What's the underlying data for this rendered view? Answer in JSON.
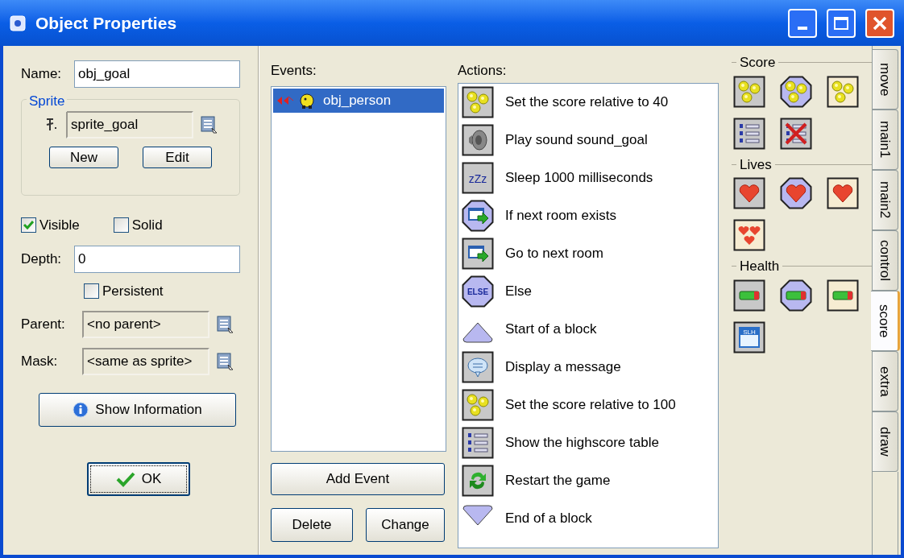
{
  "window": {
    "title": "Object Properties"
  },
  "name": {
    "label": "Name:",
    "value": "obj_goal"
  },
  "sprite": {
    "title": "Sprite",
    "value": "sprite_goal",
    "buttons": [
      "New",
      "Edit"
    ]
  },
  "checkboxes": [
    {
      "label": "Visible",
      "checked": true
    },
    {
      "label": "Solid",
      "checked": false
    }
  ],
  "depth": {
    "label": "Depth:",
    "value": "0"
  },
  "persistent": {
    "label": "Persistent",
    "checked": false
  },
  "parent": {
    "label": "Parent:",
    "value": "<no parent>"
  },
  "mask": {
    "label": "Mask:",
    "value": "<same as sprite>"
  },
  "show_information": "Show Information",
  "ok": "OK",
  "events": {
    "label": "Events:",
    "items": [
      {
        "label": "obj_person",
        "selected": true
      }
    ],
    "buttons": {
      "add": "Add Event",
      "delete": "Delete",
      "change": "Change"
    }
  },
  "actions": {
    "label": "Actions:",
    "items": [
      {
        "kind": "coins",
        "text": "Set the score relative to 40"
      },
      {
        "kind": "speaker",
        "text": "Play sound sound_goal"
      },
      {
        "kind": "sleep",
        "icon_text": "zZz",
        "text": "Sleep 1000 milliseconds"
      },
      {
        "kind": "if_room",
        "text": "If next room exists"
      },
      {
        "kind": "next_room",
        "text": "Go to next room"
      },
      {
        "kind": "else",
        "icon_text": "ELSE",
        "text": "Else"
      },
      {
        "kind": "start_block",
        "text": "Start of a block"
      },
      {
        "kind": "message",
        "text": "Display a message"
      },
      {
        "kind": "coins",
        "text": "Set the score relative to 100"
      },
      {
        "kind": "highscore",
        "text": "Show the highscore table"
      },
      {
        "kind": "restart",
        "text": "Restart the game"
      },
      {
        "kind": "end_block",
        "text": "End of a block"
      }
    ]
  },
  "library": [
    {
      "title": "Score",
      "items": [
        {
          "kind": "score_set"
        },
        {
          "kind": "score_test"
        },
        {
          "kind": "score_draw"
        },
        {
          "kind": "highscore_show"
        },
        {
          "kind": "highscore_clear"
        }
      ]
    },
    {
      "title": "Lives",
      "items": [
        {
          "kind": "lives_set"
        },
        {
          "kind": "lives_test"
        },
        {
          "kind": "lives_draw"
        },
        {
          "kind": "lives_draw_image"
        }
      ]
    },
    {
      "title": "Health",
      "items": [
        {
          "kind": "health_set"
        },
        {
          "kind": "health_test"
        },
        {
          "kind": "health_draw"
        },
        {
          "kind": "caption",
          "icon_text": "SLH"
        }
      ]
    }
  ],
  "tabs": [
    {
      "label": "move",
      "selected": false
    },
    {
      "label": "main1",
      "selected": false
    },
    {
      "label": "main2",
      "selected": false
    },
    {
      "label": "control",
      "selected": false
    },
    {
      "label": "score",
      "selected": true
    },
    {
      "label": "extra",
      "selected": false
    },
    {
      "label": "draw",
      "selected": false
    }
  ]
}
